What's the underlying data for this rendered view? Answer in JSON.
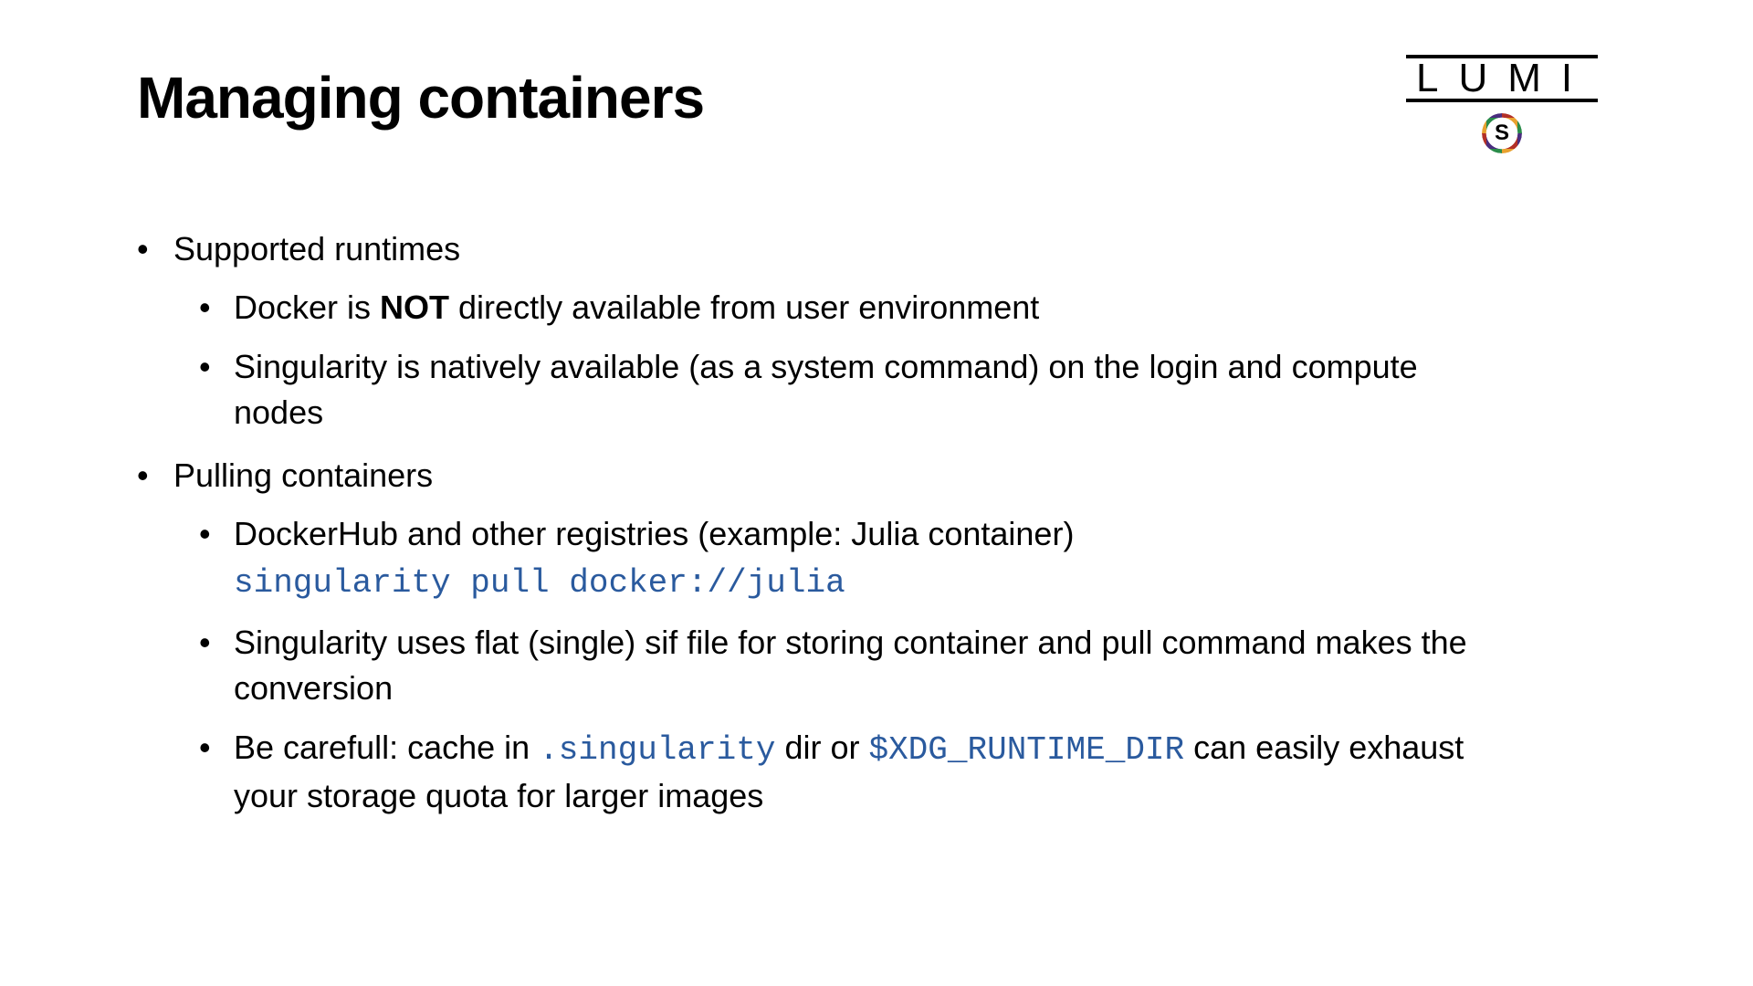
{
  "title": "Managing containers",
  "logo": {
    "lumi": "LUMI",
    "s_letter": "S"
  },
  "bullets": {
    "b1": {
      "label": "Supported runtimes",
      "sub1_pre": "Docker is ",
      "sub1_bold": "NOT",
      "sub1_post": " directly available from user environment",
      "sub2": "Singularity is natively available (as a system command) on the login and compute nodes"
    },
    "b2": {
      "label": "Pulling containers",
      "sub1_text": "DockerHub and other registries (example: Julia container)",
      "sub1_code": "singularity pull docker://julia",
      "sub2": "Singularity uses flat (single) sif file for storing container and pull command makes the conversion",
      "sub3_pre": "Be carefull: cache in ",
      "sub3_code1": ".singularity",
      "sub3_mid": " dir or ",
      "sub3_code2": "$XDG_RUNTIME_DIR",
      "sub3_post": " can easily exhaust your storage quota for larger images"
    }
  }
}
